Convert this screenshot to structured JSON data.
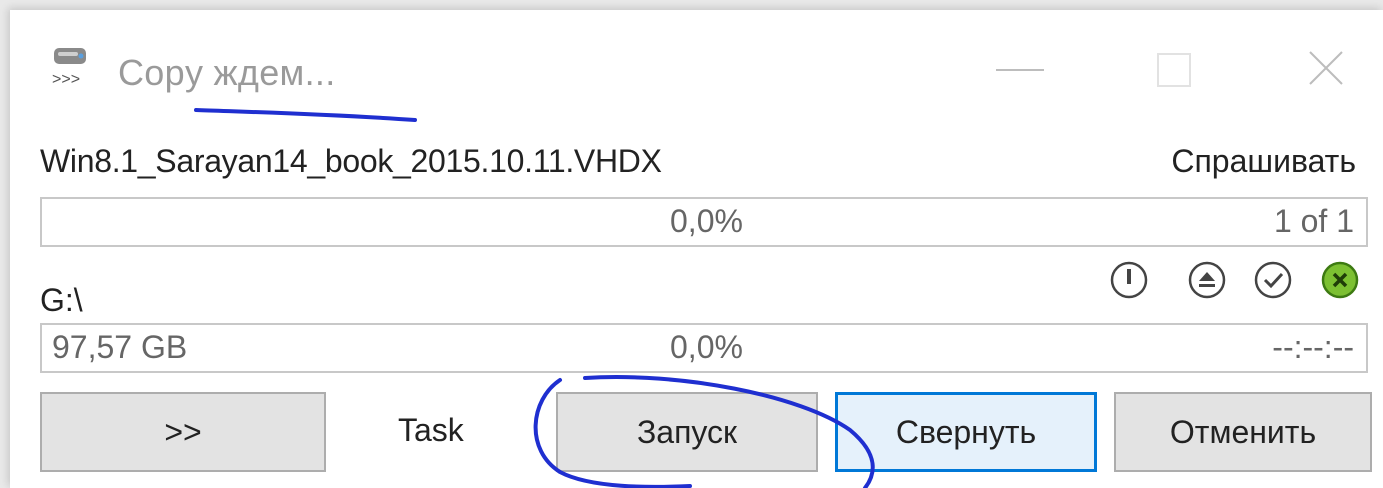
{
  "window": {
    "title": "Copy ждем...",
    "app_icon": "drive-copy-icon",
    "controls": [
      "minimize-icon",
      "maximize-icon",
      "close-icon"
    ]
  },
  "file": {
    "name": "Win8.1_Sarayan14_book_2015.10.11.VHDX",
    "mode": "Спрашивать",
    "progress_percent": "0,0%",
    "progress_value": 0,
    "counter": "1 of 1"
  },
  "total": {
    "drive": "G:\\",
    "size": "97,57 GB",
    "progress_percent": "0,0%",
    "progress_value": 0,
    "time": "--:--:--"
  },
  "action_icons": [
    "pause-circle-icon",
    "eject-circle-icon",
    "check-circle-icon",
    "cancel-circle-icon"
  ],
  "accent_colors": {
    "focus": "#0078d7",
    "cancel_icon": "#7cc032",
    "annotation": "#1f2fd0"
  },
  "buttons": {
    "more": ">>",
    "task": "Task",
    "start": "Запуск",
    "minimize": "Свернуть",
    "cancel": "Отменить"
  }
}
